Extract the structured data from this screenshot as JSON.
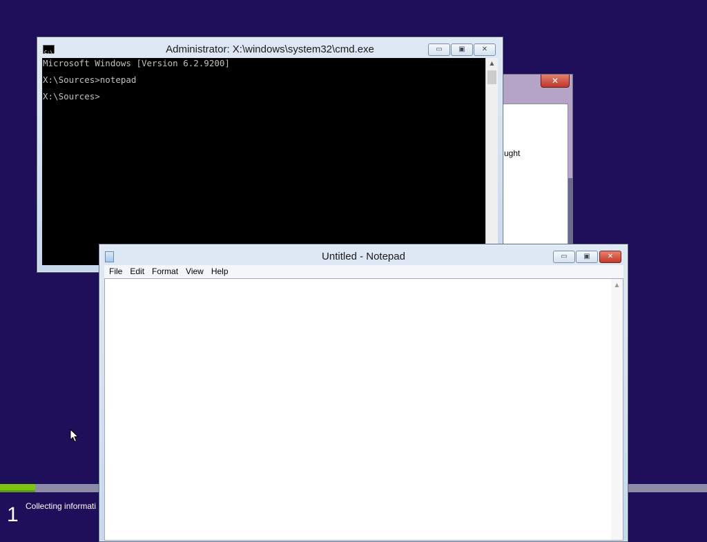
{
  "setup": {
    "progress": 0.05,
    "step_number": "1",
    "step_text": "Collecting informati"
  },
  "background_dialog": {
    "partial_text": "ught",
    "close_label": "✕"
  },
  "cmd_window": {
    "title": "Administrator: X:\\windows\\system32\\cmd.exe",
    "icon_label": "C:\\.",
    "lines": [
      "Microsoft Windows [Version 6.2.9200]",
      "",
      "X:\\Sources>notepad",
      "",
      "X:\\Sources>"
    ]
  },
  "notepad_window": {
    "title": "Untitled - Notepad",
    "menu": [
      "File",
      "Edit",
      "Format",
      "View",
      "Help"
    ],
    "content": ""
  },
  "window_controls": {
    "minimize": "▭",
    "maximize": "▣",
    "close": "✕"
  },
  "colors": {
    "desktop_bg": "#1f0e5a",
    "progress_fill": "#7dc314",
    "close_red": "#c23b28"
  }
}
